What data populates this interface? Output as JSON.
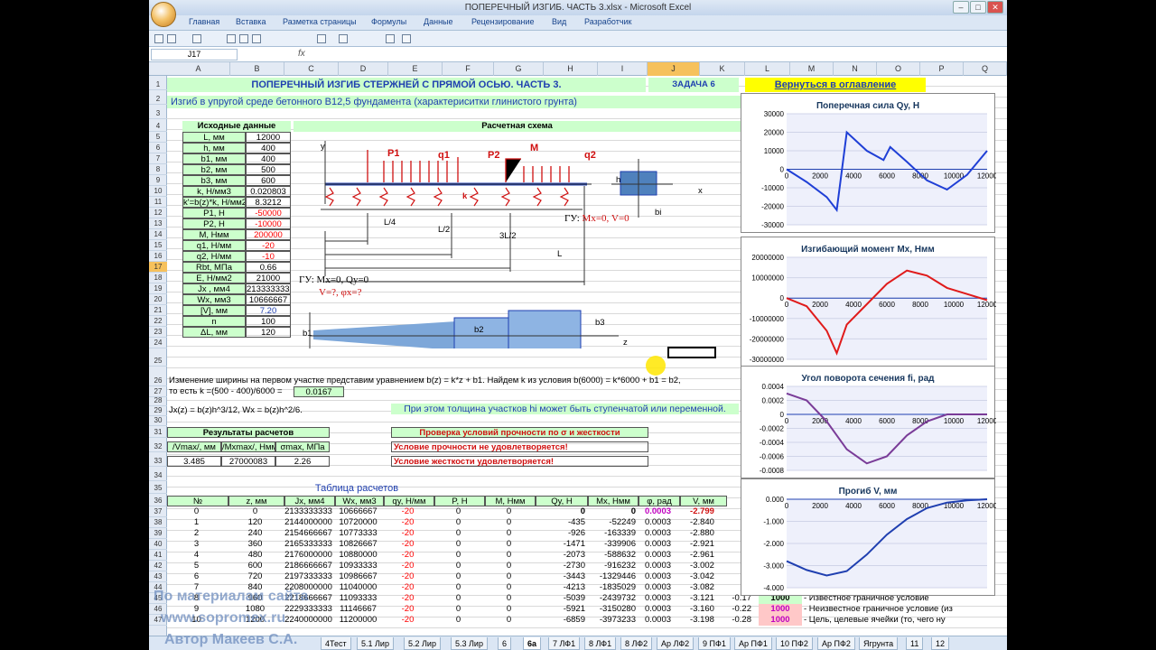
{
  "window": {
    "title": "ПОПЕРЕЧНЫЙ ИЗГИБ. ЧАСТЬ 3.xlsx - Microsoft Excel"
  },
  "menu": [
    "Главная",
    "Вставка",
    "Разметка страницы",
    "Формулы",
    "Данные",
    "Рецензирование",
    "Вид",
    "Разработчик"
  ],
  "namebox": "J17",
  "fx": "fx",
  "cols": [
    "A",
    "B",
    "C",
    "D",
    "E",
    "F",
    "G",
    "H",
    "I",
    "J",
    "K",
    "L",
    "M",
    "N",
    "O",
    "P",
    "Q"
  ],
  "rows": [
    "1",
    "2",
    "3",
    "4",
    "5",
    "6",
    "7",
    "8",
    "9",
    "10",
    "11",
    "12",
    "13",
    "14",
    "15",
    "16",
    "17",
    "18",
    "19",
    "20",
    "21",
    "22",
    "23",
    "24",
    "25",
    "26",
    "27",
    "28",
    "29",
    "30",
    "31",
    "32",
    "33",
    "34",
    "35",
    "36",
    "37",
    "38",
    "39",
    "40",
    "41",
    "42",
    "43",
    "44",
    "45",
    "46",
    "47"
  ],
  "sheet": {
    "title": "ПОПЕРЕЧНЫЙ ИЗГИБ СТЕРЖНЕЙ С ПРЯМОЙ ОСЬЮ. ЧАСТЬ 3.",
    "task": "ЗАДАЧА 6",
    "back": "Вернуться в оглавление",
    "subtitle": "Изгиб в упругой среде бетонного В12,5 фундамента (характериситки глинистого грунта)",
    "input_header": "Исходные данные",
    "scheme_header": "Расчетная схема",
    "inputs": [
      {
        "k": "L, мм",
        "v": "12000"
      },
      {
        "k": "h, мм",
        "v": "400"
      },
      {
        "k": "b1, мм",
        "v": "400"
      },
      {
        "k": "b2, мм",
        "v": "500"
      },
      {
        "k": "b3, мм",
        "v": "600"
      },
      {
        "k": "k, Н/мм3",
        "v": "0.020803"
      },
      {
        "k": "k'=b(z)*k, Н/мм2",
        "v": "8.3212"
      },
      {
        "k": "P1, Н",
        "v": "-50000",
        "red": true
      },
      {
        "k": "P2, Н",
        "v": "-10000",
        "red": true
      },
      {
        "k": "M, Нмм",
        "v": "200000",
        "red": true
      },
      {
        "k": "q1, Н/мм",
        "v": "-20",
        "red": true
      },
      {
        "k": "q2, Н/мм",
        "v": "-10",
        "red": true
      },
      {
        "k": "Rbt, МПа",
        "v": "0.66"
      },
      {
        "k": "E, Н/мм2",
        "v": "21000"
      },
      {
        "k": "Jx , мм4",
        "v": "2133333333"
      },
      {
        "k": "Wx, мм3",
        "v": "10666667"
      },
      {
        "k": "[V], мм",
        "v": "7.20"
      },
      {
        "k": "n",
        "v": "100"
      },
      {
        "k": "ΔL, мм",
        "v": "120"
      }
    ],
    "scheme": {
      "y": "y",
      "P1": "P1",
      "q1": "q1",
      "P2": "P2",
      "M": "M",
      "q2": "q2",
      "k": "k",
      "h": "h",
      "x": "x",
      "bi": "bi",
      "gu_right": "ГУ: Мх=0, V=0",
      "L4": "L/4",
      "L2": "L/2",
      "L3": "3L/2",
      "L": "L",
      "gu_left": "ГУ: Мх=0, Qy=0",
      "q_left": "V=?, φх=?",
      "b1": "b1",
      "b2": "b2",
      "b3": "b3",
      "z": "z"
    },
    "r26": "Изменение ширины на первом участке представим уравнением  b(z) = k*z + b1. Найдем k из условия b(6000) = k*6000 + b1 = b2,",
    "r27": "то есть k =(500 - 400)/6000 =",
    "r27v": "0.0167",
    "r29a": "Jx(z) = b(z)h^3/12,  Wx = b(z)h^2/6.",
    "r29b": "При этом толщина участков hi может быть ступенчатой или переменной.",
    "res_header": "Результаты расчетов",
    "res_cols": [
      "/Vmax/, мм",
      "/Mxmax/, Нмм",
      "σmax, МПа"
    ],
    "res_vals": [
      "3.485",
      "27000083",
      "2.26"
    ],
    "check_header": "Проверка условий прочности по σ и жесткости",
    "check1": "Условие прочности не удовлетворяется!",
    "check2": "Условие жесткости удовлетворяется!",
    "table_title": "Таблица расчетов",
    "table_cols": [
      "№",
      "z, мм",
      "Jx, мм4",
      "Wx, мм3",
      "qy, Н/мм",
      "P, Н",
      "M, Нмм",
      "Qy, Н",
      "Mx, Нмм",
      "φ, рад",
      "V, мм"
    ],
    "table_rows": [
      [
        "0",
        "0",
        "2133333333",
        "10666667",
        "-20",
        "0",
        "0",
        "0",
        "0",
        "0.0003",
        "-2.799"
      ],
      [
        "1",
        "120",
        "2144000000",
        "10720000",
        "-20",
        "0",
        "0",
        "-435",
        "-52249",
        "0.0003",
        "-2.840"
      ],
      [
        "2",
        "240",
        "2154666667",
        "10773333",
        "-20",
        "0",
        "0",
        "-926",
        "-163339",
        "0.0003",
        "-2.880"
      ],
      [
        "3",
        "360",
        "2165333333",
        "10826667",
        "-20",
        "0",
        "0",
        "-1471",
        "-339906",
        "0.0003",
        "-2.921"
      ],
      [
        "4",
        "480",
        "2176000000",
        "10880000",
        "-20",
        "0",
        "0",
        "-2073",
        "-588632",
        "0.0003",
        "-2.961"
      ],
      [
        "5",
        "600",
        "2186666667",
        "10933333",
        "-20",
        "0",
        "0",
        "-2730",
        "-916232",
        "0.0003",
        "-3.002"
      ],
      [
        "6",
        "720",
        "2197333333",
        "10986667",
        "-20",
        "0",
        "0",
        "-3443",
        "-1329446",
        "0.0003",
        "-3.042"
      ],
      [
        "7",
        "840",
        "2208000000",
        "11040000",
        "-20",
        "0",
        "0",
        "-4213",
        "-1835029",
        "0.0003",
        "-3.082"
      ],
      [
        "8",
        "960",
        "2218666667",
        "11093333",
        "-20",
        "0",
        "0",
        "-5039",
        "-2439732",
        "0.0003",
        "-3.121"
      ],
      [
        "9",
        "1080",
        "2229333333",
        "11146667",
        "-20",
        "0",
        "0",
        "-5921",
        "-3150280",
        "0.0003",
        "-3.160"
      ],
      [
        "10",
        "1200",
        "2240000000",
        "11200000",
        "-20",
        "0",
        "0",
        "-6859",
        "-3973233",
        "0.0003",
        "-3.198"
      ]
    ],
    "legend": [
      {
        "k": "-0.17",
        "v": "1000",
        "t": "- Известное граничное условие"
      },
      {
        "k": "-0.22",
        "v": "1000",
        "t": "- Неизвестное граничное условие (из"
      },
      {
        "k": "-0.28",
        "v": "1000",
        "t": "- Цель, целевые ячейки (то, чего ну"
      }
    ]
  },
  "charts": [
    {
      "title": "Поперечная сила Qy, Н",
      "yt": [
        "30000",
        "20000",
        "10000",
        "0",
        "-10000",
        "-20000",
        "-30000"
      ],
      "xt": [
        "0",
        "2000",
        "4000",
        "6000",
        "8000",
        "10000",
        "12000"
      ]
    },
    {
      "title": "Изгибающий момент Мх, Нмм",
      "yt": [
        "20000000",
        "10000000",
        "0",
        "-10000000",
        "-20000000",
        "-30000000"
      ],
      "xt": [
        "0",
        "2000",
        "4000",
        "6000",
        "8000",
        "10000",
        "12000"
      ]
    },
    {
      "title": "Угол поворота сечения fi, рад",
      "yt": [
        "0.0004",
        "0.0002",
        "0",
        "-0.0002",
        "-0.0004",
        "-0.0006",
        "-0.0008"
      ],
      "xt": [
        "0",
        "2000",
        "4000",
        "6000",
        "8000",
        "10000",
        "12000"
      ]
    },
    {
      "title": "Прогиб V, мм",
      "yt": [
        "0.000",
        "-1.000",
        "-2.000",
        "-3.000",
        "-4.000"
      ],
      "xt": [
        "0",
        "2000",
        "4000",
        "6000",
        "8000",
        "10000",
        "12000"
      ]
    }
  ],
  "chart_data": [
    {
      "type": "line",
      "title": "Поперечная сила Qy, Н",
      "x": [
        0,
        1200,
        2400,
        3000,
        3600,
        4800,
        5800,
        6200,
        7200,
        8400,
        9600,
        10800,
        12000
      ],
      "values": [
        0,
        -6859,
        -15000,
        -22000,
        20000,
        10000,
        5000,
        12000,
        4000,
        -6000,
        -11000,
        -3000,
        10000
      ],
      "ylim": [
        -30000,
        30000
      ],
      "xlim": [
        0,
        12000
      ],
      "color": "#1f3fd6"
    },
    {
      "type": "line",
      "title": "Изгибающий момент Мх, Нмм",
      "x": [
        0,
        1200,
        2400,
        3000,
        3600,
        4800,
        6000,
        7200,
        8400,
        9600,
        10800,
        12000
      ],
      "values": [
        0,
        -4000000,
        -16000000,
        -27000000,
        -13000000,
        -3000000,
        7000000,
        13500000,
        11000000,
        5000000,
        2000000,
        -1000000
      ],
      "ylim": [
        -30000000,
        20000000
      ],
      "xlim": [
        0,
        12000
      ],
      "color": "#e01b1b"
    },
    {
      "type": "line",
      "title": "Угол поворота сечения fi, рад",
      "x": [
        0,
        1200,
        2400,
        3600,
        4800,
        6000,
        7200,
        8400,
        9600,
        10800,
        12000
      ],
      "values": [
        0.0003,
        0.0002,
        -0.0001,
        -0.0005,
        -0.0007,
        -0.0006,
        -0.0003,
        -0.0001,
        0.0,
        0.0,
        0.0
      ],
      "ylim": [
        -0.0008,
        0.0004
      ],
      "xlim": [
        0,
        12000
      ],
      "color": "#7a3c98"
    },
    {
      "type": "line",
      "title": "Прогиб V, мм",
      "x": [
        0,
        1200,
        2400,
        3600,
        4800,
        6000,
        7200,
        8400,
        9600,
        10800,
        12000
      ],
      "values": [
        -2.799,
        -3.198,
        -3.45,
        -3.25,
        -2.5,
        -1.6,
        -0.9,
        -0.4,
        -0.15,
        -0.05,
        0
      ],
      "ylim": [
        -4,
        0
      ],
      "xlim": [
        0,
        12000
      ],
      "color": "#1f3fb0"
    }
  ],
  "tabs": [
    "4Тест",
    "5.1 Лир",
    "5.2 Лир",
    "5.3 Лир",
    "6",
    "6а",
    "7 ЛФ1",
    "8 ЛФ1",
    "8 ЛФ2",
    "Ар ЛФ2",
    "9 ПФ1",
    "Ар ПФ1",
    "10 ПФ2",
    "Ар ПФ2",
    "Ягрунта",
    "11",
    "12"
  ],
  "active_tab": "6а",
  "watermark": {
    "l1": "По материалам сайта",
    "l2": "www.sopromex.ru",
    "l3": "Автор Макеев С.А."
  }
}
